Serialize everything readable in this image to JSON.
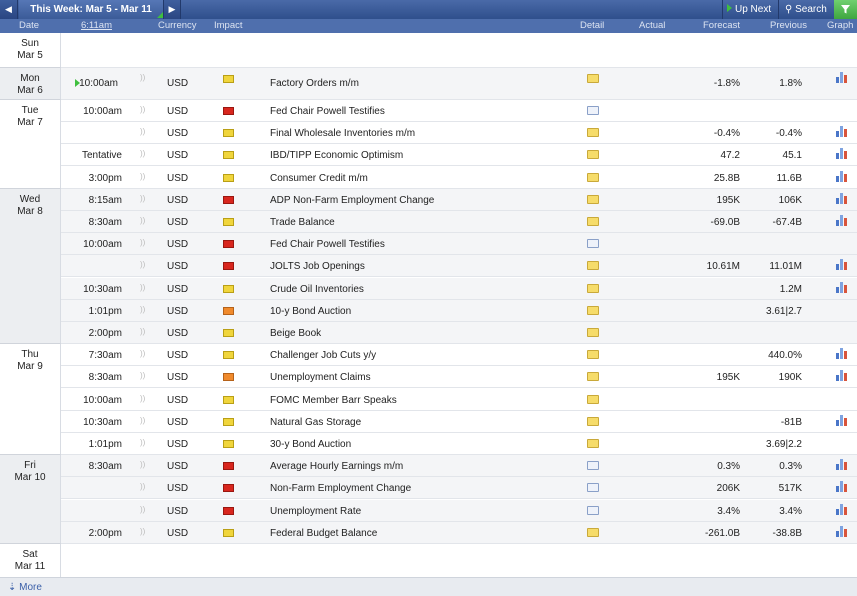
{
  "nav": {
    "prev": "◀",
    "next": "▶",
    "week_title": "This Week: Mar 5 - Mar 11",
    "up_next": "Up Next",
    "search": "Search",
    "filter_icon": "funnel-icon"
  },
  "columns": {
    "date": "Date",
    "time": "6:11am",
    "currency": "Currency",
    "impact": "Impact",
    "detail": "Detail",
    "actual": "Actual",
    "forecast": "Forecast",
    "previous": "Previous",
    "graph": "Graph"
  },
  "colors": {
    "header": "#4f6fad",
    "impact_high": "#d8261e",
    "impact_medium": "#f08a2c",
    "impact_low": "#f0d53c"
  },
  "days": [
    {
      "day": "Sun",
      "date": "Mar 5"
    },
    {
      "day": "Mon",
      "date": "Mar 6"
    },
    {
      "day": "Tue",
      "date": "Mar 7"
    },
    {
      "day": "Wed",
      "date": "Mar 8"
    },
    {
      "day": "Thu",
      "date": "Mar 9"
    },
    {
      "day": "Fri",
      "date": "Mar 10"
    },
    {
      "day": "Sat",
      "date": "Mar 11"
    }
  ],
  "events": [
    {
      "time": "10:00am",
      "currency": "USD",
      "impact": "low",
      "event": "Factory Orders m/m",
      "detail": "folder",
      "forecast": "-1.8%",
      "previous": "1.8%",
      "graph": true
    },
    {
      "time": "10:00am",
      "currency": "USD",
      "impact": "high",
      "event": "Fed Chair Powell Testifies",
      "detail": "new",
      "forecast": "",
      "previous": "",
      "graph": false
    },
    {
      "time": "",
      "currency": "USD",
      "impact": "low",
      "event": "Final Wholesale Inventories m/m",
      "detail": "folder",
      "forecast": "-0.4%",
      "previous": "-0.4%",
      "graph": true
    },
    {
      "time": "Tentative",
      "currency": "USD",
      "impact": "low",
      "event": "IBD/TIPP Economic Optimism",
      "detail": "folder",
      "forecast": "47.2",
      "previous": "45.1",
      "graph": true
    },
    {
      "time": "3:00pm",
      "currency": "USD",
      "impact": "low",
      "event": "Consumer Credit m/m",
      "detail": "folder",
      "forecast": "25.8B",
      "previous": "11.6B",
      "graph": true
    },
    {
      "time": "8:15am",
      "currency": "USD",
      "impact": "high",
      "event": "ADP Non-Farm Employment Change",
      "detail": "folder",
      "forecast": "195K",
      "previous": "106K",
      "graph": true
    },
    {
      "time": "8:30am",
      "currency": "USD",
      "impact": "low",
      "event": "Trade Balance",
      "detail": "folder",
      "forecast": "-69.0B",
      "previous": "-67.4B",
      "graph": true
    },
    {
      "time": "10:00am",
      "currency": "USD",
      "impact": "high",
      "event": "Fed Chair Powell Testifies",
      "detail": "new",
      "forecast": "",
      "previous": "",
      "graph": false
    },
    {
      "time": "",
      "currency": "USD",
      "impact": "high",
      "event": "JOLTS Job Openings",
      "detail": "folder",
      "forecast": "10.61M",
      "previous": "11.01M",
      "graph": true
    },
    {
      "time": "10:30am",
      "currency": "USD",
      "impact": "low",
      "event": "Crude Oil Inventories",
      "detail": "folder",
      "forecast": "",
      "previous": "1.2M",
      "graph": true
    },
    {
      "time": "1:01pm",
      "currency": "USD",
      "impact": "medium",
      "event": "10-y Bond Auction",
      "detail": "folder",
      "forecast": "",
      "previous": "3.61|2.7",
      "graph": false
    },
    {
      "time": "2:00pm",
      "currency": "USD",
      "impact": "low",
      "event": "Beige Book",
      "detail": "folder",
      "forecast": "",
      "previous": "",
      "graph": false
    },
    {
      "time": "7:30am",
      "currency": "USD",
      "impact": "low",
      "event": "Challenger Job Cuts y/y",
      "detail": "folder",
      "forecast": "",
      "previous": "440.0%",
      "graph": true
    },
    {
      "time": "8:30am",
      "currency": "USD",
      "impact": "medium",
      "event": "Unemployment Claims",
      "detail": "folder",
      "forecast": "195K",
      "previous": "190K",
      "graph": true
    },
    {
      "time": "10:00am",
      "currency": "USD",
      "impact": "low",
      "event": "FOMC Member Barr Speaks",
      "detail": "folder",
      "forecast": "",
      "previous": "",
      "graph": false
    },
    {
      "time": "10:30am",
      "currency": "USD",
      "impact": "low",
      "event": "Natural Gas Storage",
      "detail": "folder",
      "forecast": "",
      "previous": "-81B",
      "graph": true
    },
    {
      "time": "1:01pm",
      "currency": "USD",
      "impact": "low",
      "event": "30-y Bond Auction",
      "detail": "folder",
      "forecast": "",
      "previous": "3.69|2.2",
      "graph": false
    },
    {
      "time": "8:30am",
      "currency": "USD",
      "impact": "high",
      "event": "Average Hourly Earnings m/m",
      "detail": "new",
      "forecast": "0.3%",
      "previous": "0.3%",
      "graph": true
    },
    {
      "time": "",
      "currency": "USD",
      "impact": "high",
      "event": "Non-Farm Employment Change",
      "detail": "new",
      "forecast": "206K",
      "previous": "517K",
      "graph": true
    },
    {
      "time": "",
      "currency": "USD",
      "impact": "high",
      "event": "Unemployment Rate",
      "detail": "new",
      "forecast": "3.4%",
      "previous": "3.4%",
      "graph": true
    },
    {
      "time": "2:00pm",
      "currency": "USD",
      "impact": "low",
      "event": "Federal Budget Balance",
      "detail": "folder",
      "forecast": "-261.0B",
      "previous": "-38.8B",
      "graph": true
    }
  ],
  "more": "⇣ More"
}
